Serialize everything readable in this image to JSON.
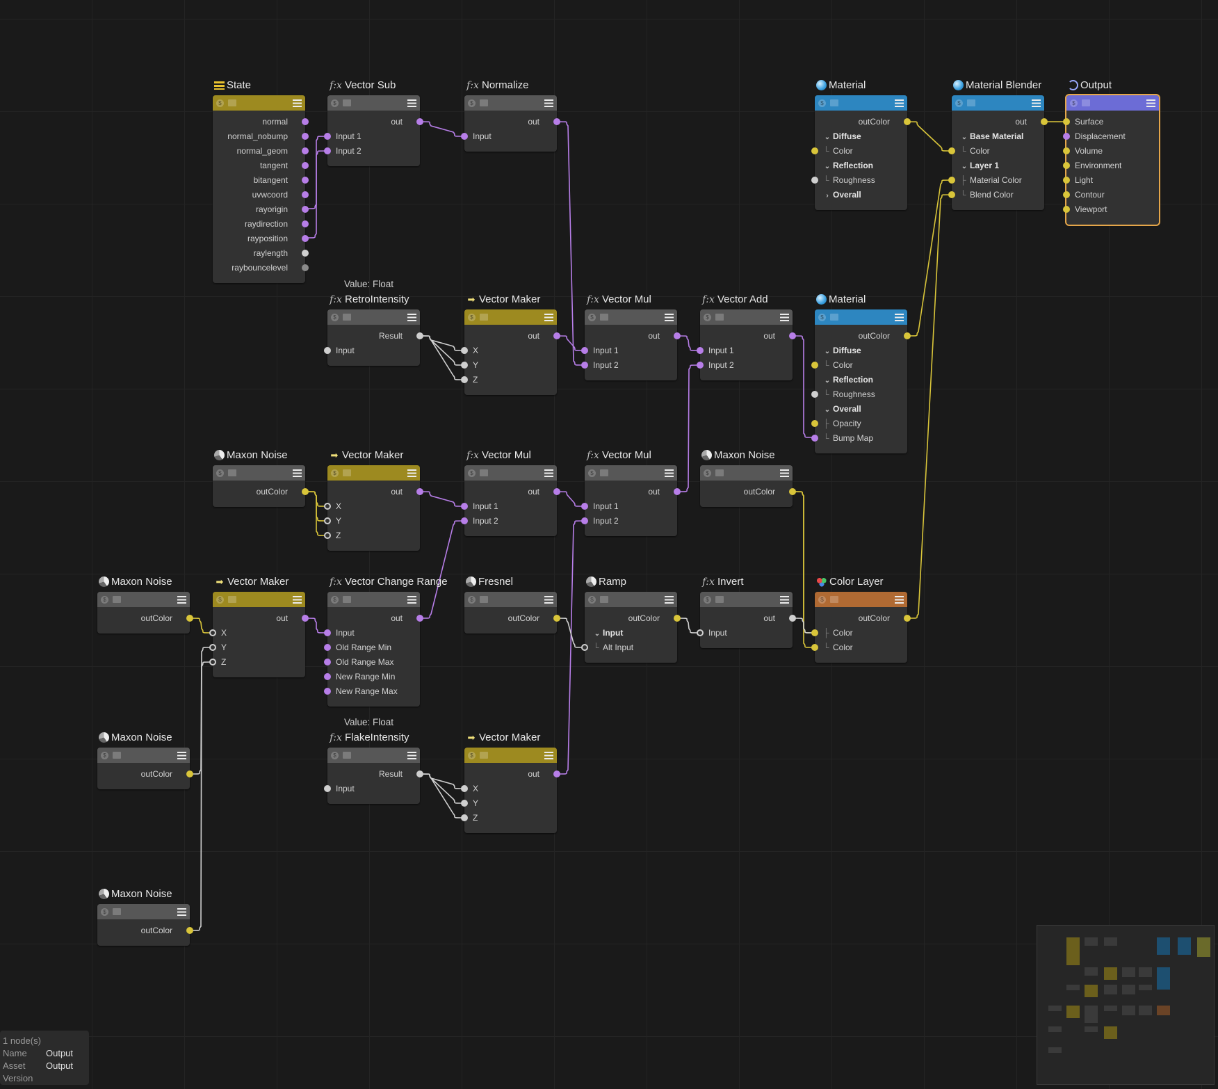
{
  "colors": {
    "int_wire": "#b77ee8",
    "color_wire": "#d9c53a",
    "value_wire": "#cfcfcf",
    "selected_outline": "#e5a64a"
  },
  "nodes": {
    "state": {
      "title": "State",
      "icon": "state-icon",
      "outputs": [
        "normal",
        "normal_nobump",
        "normal_geom",
        "tangent",
        "bitangent",
        "uvwcoord",
        "rayorigin",
        "raydirection",
        "rayposition",
        "raylength",
        "raybouncelevel"
      ]
    },
    "vector_sub": {
      "title": "Vector Sub",
      "icon": "fx-icon",
      "out": "out",
      "inputs": [
        "Input 1",
        "Input 2"
      ]
    },
    "normalize": {
      "title": "Normalize",
      "icon": "fx-icon",
      "out": "out",
      "inputs": [
        "Input"
      ]
    },
    "material_top": {
      "title": "Material",
      "icon": "material-sphere-icon",
      "out": "outColor",
      "rows": [
        "Diffuse",
        "Color",
        "Reflection",
        "Roughness",
        "Overall"
      ]
    },
    "material_blender": {
      "title": "Material Blender",
      "icon": "material-sphere-icon",
      "out": "out",
      "rows": [
        "Base Material",
        "Color",
        "Layer 1",
        "Material Color",
        "Blend Color"
      ]
    },
    "output": {
      "title": "Output",
      "icon": "output-icon",
      "inputs": [
        "Surface",
        "Displacement",
        "Volume",
        "Environment",
        "Light",
        "Contour",
        "Viewport"
      ]
    },
    "retro": {
      "subtitle": "Value: Float",
      "title": "RetroIntensity",
      "icon": "fx-icon",
      "out": "Result",
      "inputs": [
        "Input"
      ]
    },
    "vm1": {
      "title": "Vector Maker",
      "icon": "vector-maker-icon",
      "out": "out",
      "inputs": [
        "X",
        "Y",
        "Z"
      ]
    },
    "vmul1": {
      "title": "Vector Mul",
      "icon": "fx-icon",
      "out": "out",
      "inputs": [
        "Input 1",
        "Input 2"
      ]
    },
    "vadd": {
      "title": "Vector Add",
      "icon": "fx-icon",
      "out": "out",
      "inputs": [
        "Input 1",
        "Input 2"
      ]
    },
    "material_mid": {
      "title": "Material",
      "icon": "material-sphere-icon",
      "out": "outColor",
      "rows": [
        "Diffuse",
        "Color",
        "Reflection",
        "Roughness",
        "Overall",
        "Opacity",
        "Bump Map"
      ]
    },
    "noise1": {
      "title": "Maxon Noise",
      "icon": "noise-icon",
      "out": "outColor"
    },
    "vm2": {
      "title": "Vector Maker",
      "icon": "vector-maker-icon",
      "out": "out",
      "inputs": [
        "X",
        "Y",
        "Z"
      ]
    },
    "vmul2": {
      "title": "Vector Mul",
      "icon": "fx-icon",
      "out": "out",
      "inputs": [
        "Input 1",
        "Input 2"
      ]
    },
    "vmul3": {
      "title": "Vector Mul",
      "icon": "fx-icon",
      "out": "out",
      "inputs": [
        "Input 1",
        "Input 2"
      ]
    },
    "noise2": {
      "title": "Maxon Noise",
      "icon": "noise-icon",
      "out": "outColor"
    },
    "noise3": {
      "title": "Maxon Noise",
      "icon": "noise-icon",
      "out": "outColor"
    },
    "vm3": {
      "title": "Vector Maker",
      "icon": "vector-maker-icon",
      "out": "out",
      "inputs": [
        "X",
        "Y",
        "Z"
      ]
    },
    "vcr": {
      "title": "Vector Change Range",
      "icon": "fx-icon",
      "out": "out",
      "inputs": [
        "Input",
        "Old Range Min",
        "Old Range Max",
        "New Range Min",
        "New Range Max"
      ]
    },
    "fresnel": {
      "title": "Fresnel",
      "icon": "noise-icon",
      "out": "outColor"
    },
    "ramp": {
      "title": "Ramp",
      "icon": "noise-icon",
      "out": "outColor",
      "rows": [
        "Input",
        "Alt Input"
      ]
    },
    "invert": {
      "title": "Invert",
      "icon": "fx-icon",
      "out": "out",
      "inputs": [
        "Input"
      ]
    },
    "color_layer": {
      "title": "Color Layer",
      "icon": "color-layer-icon",
      "out": "outColor",
      "inputs": [
        "Color",
        "Color"
      ]
    },
    "noise4": {
      "title": "Maxon Noise",
      "icon": "noise-icon",
      "out": "outColor"
    },
    "flake": {
      "subtitle": "Value: Float",
      "title": "FlakeIntensity",
      "icon": "fx-icon",
      "out": "Result",
      "inputs": [
        "Input"
      ]
    },
    "vm4": {
      "title": "Vector Maker",
      "icon": "vector-maker-icon",
      "out": "out",
      "inputs": [
        "X",
        "Y",
        "Z"
      ]
    },
    "noise5": {
      "title": "Maxon Noise",
      "icon": "noise-icon",
      "out": "outColor"
    }
  },
  "info": {
    "count": "1 node(s)",
    "name_label": "Name",
    "name": "Output",
    "asset_label": "Asset",
    "asset": "Output",
    "version_label": "Version"
  }
}
